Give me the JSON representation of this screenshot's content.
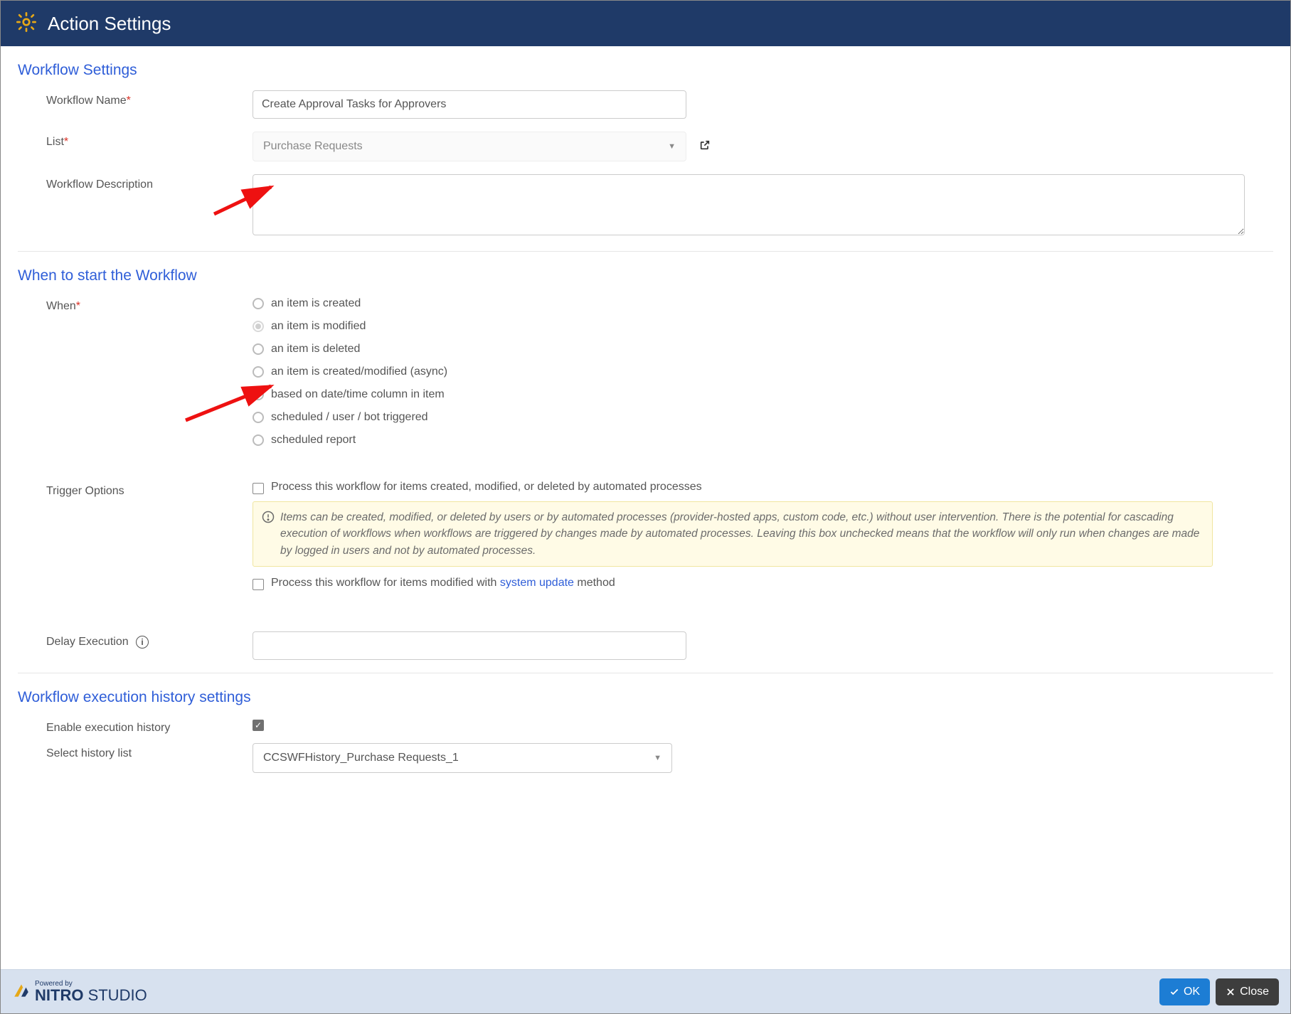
{
  "header": {
    "title": "Action Settings"
  },
  "sections": {
    "workflow": {
      "title": "Workflow Settings"
    },
    "start": {
      "title": "When to start the Workflow"
    },
    "history": {
      "title": "Workflow execution history settings"
    }
  },
  "labels": {
    "workflow_name": "Workflow Name",
    "list": "List",
    "workflow_description": "Workflow Description",
    "when": "When",
    "trigger_options": "Trigger Options",
    "delay_execution": "Delay Execution",
    "enable_history": "Enable execution history",
    "select_history_list": "Select history list"
  },
  "values": {
    "workflow_name": "Create Approval Tasks for Approvers",
    "list": "Purchase Requests",
    "workflow_description": "",
    "delay_execution": "",
    "history_list": "CCSWFHistory_Purchase Requests_1"
  },
  "radios": {
    "when": [
      {
        "label": "an item is created",
        "selected": false,
        "disabled": false
      },
      {
        "label": "an item is modified",
        "selected": true,
        "disabled": true
      },
      {
        "label": "an item is deleted",
        "selected": false,
        "disabled": false
      },
      {
        "label": "an item is created/modified (async)",
        "selected": false,
        "disabled": false
      },
      {
        "label": "based on date/time column in item",
        "selected": false,
        "disabled": false
      },
      {
        "label": "scheduled / user / bot triggered",
        "selected": false,
        "disabled": false
      },
      {
        "label": "scheduled report",
        "selected": false,
        "disabled": false
      }
    ]
  },
  "triggers": {
    "process_automated": "Process this workflow for items created, modified, or deleted by automated processes",
    "warning": "Items can be created, modified, or deleted by users or by automated processes (provider-hosted apps, custom code, etc.) without user intervention. There is the potential for cascading execution of workflows when workflows are triggered by changes made by automated processes. Leaving this box unchecked means that the workflow will only run when changes are made by logged in users and not by automated processes.",
    "process_system_update_pre": "Process this workflow for items modified with ",
    "process_system_update_link": "system update",
    "process_system_update_post": " method"
  },
  "history": {
    "enabled": true
  },
  "footer": {
    "powered_by": "Powered by",
    "brand_bold": "NITRO",
    "brand_light": " STUDIO",
    "ok": "OK",
    "close": "Close"
  }
}
